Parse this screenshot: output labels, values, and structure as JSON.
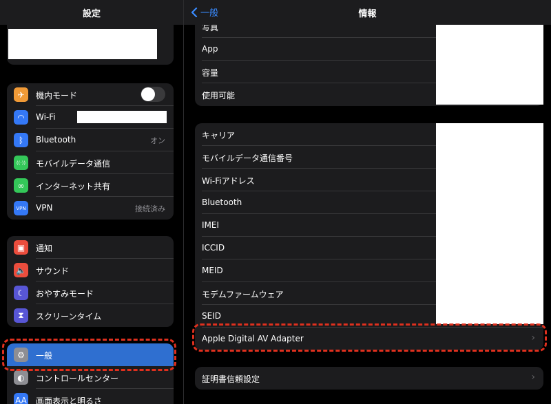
{
  "sidebar": {
    "title": "設定",
    "network": [
      {
        "label": "機内モード",
        "icon": "airplane-icon",
        "color": "#f09a37",
        "glyph": "✈"
      },
      {
        "label": "Wi-Fi",
        "icon": "wifi-icon",
        "color": "#3478f6",
        "glyph": "◠"
      },
      {
        "label": "Bluetooth",
        "icon": "bluetooth-icon",
        "color": "#3478f6",
        "glyph": "ᛒ",
        "value": "オン"
      },
      {
        "label": "モバイルデータ通信",
        "icon": "antenna-icon",
        "color": "#34c759",
        "glyph": "((·))"
      },
      {
        "label": "インターネット共有",
        "icon": "link-icon",
        "color": "#34c759",
        "glyph": "∞"
      },
      {
        "label": "VPN",
        "icon": "vpn-icon",
        "color": "#3478f6",
        "glyph": "VPN",
        "value": "接続済み"
      }
    ],
    "notifications": [
      {
        "label": "通知",
        "icon": "notification-icon",
        "color": "#eb4d3d",
        "glyph": "▣"
      },
      {
        "label": "サウンド",
        "icon": "speaker-icon",
        "color": "#eb4d3d",
        "glyph": "🔈"
      },
      {
        "label": "おやすみモード",
        "icon": "moon-icon",
        "color": "#5856d6",
        "glyph": "☾"
      },
      {
        "label": "スクリーンタイム",
        "icon": "hourglass-icon",
        "color": "#5856d6",
        "glyph": "⧗"
      }
    ],
    "general": [
      {
        "label": "一般",
        "icon": "gear-icon",
        "color": "#8e8e93",
        "glyph": "⚙"
      },
      {
        "label": "コントロールセンター",
        "icon": "toggles-icon",
        "color": "#8e8e93",
        "glyph": "◐"
      },
      {
        "label": "画面表示と明るさ",
        "icon": "text-size-icon",
        "color": "#3478f6",
        "glyph": "AA"
      }
    ]
  },
  "main": {
    "back_label": "一般",
    "title": "情報",
    "group1": [
      "写真",
      "App",
      "容量",
      "使用可能"
    ],
    "group2": [
      "キャリア",
      "モバイルデータ通信番号",
      "Wi-Fiアドレス",
      "Bluetooth",
      "IMEI",
      "ICCID",
      "MEID",
      "モデムファームウェア",
      "SEID",
      "Apple Digital AV Adapter"
    ],
    "group3": [
      "証明書信頼設定"
    ]
  },
  "colors": {
    "accent": "#3478f6",
    "selected": "#2f6fd0",
    "highlight": "#e0301e"
  }
}
